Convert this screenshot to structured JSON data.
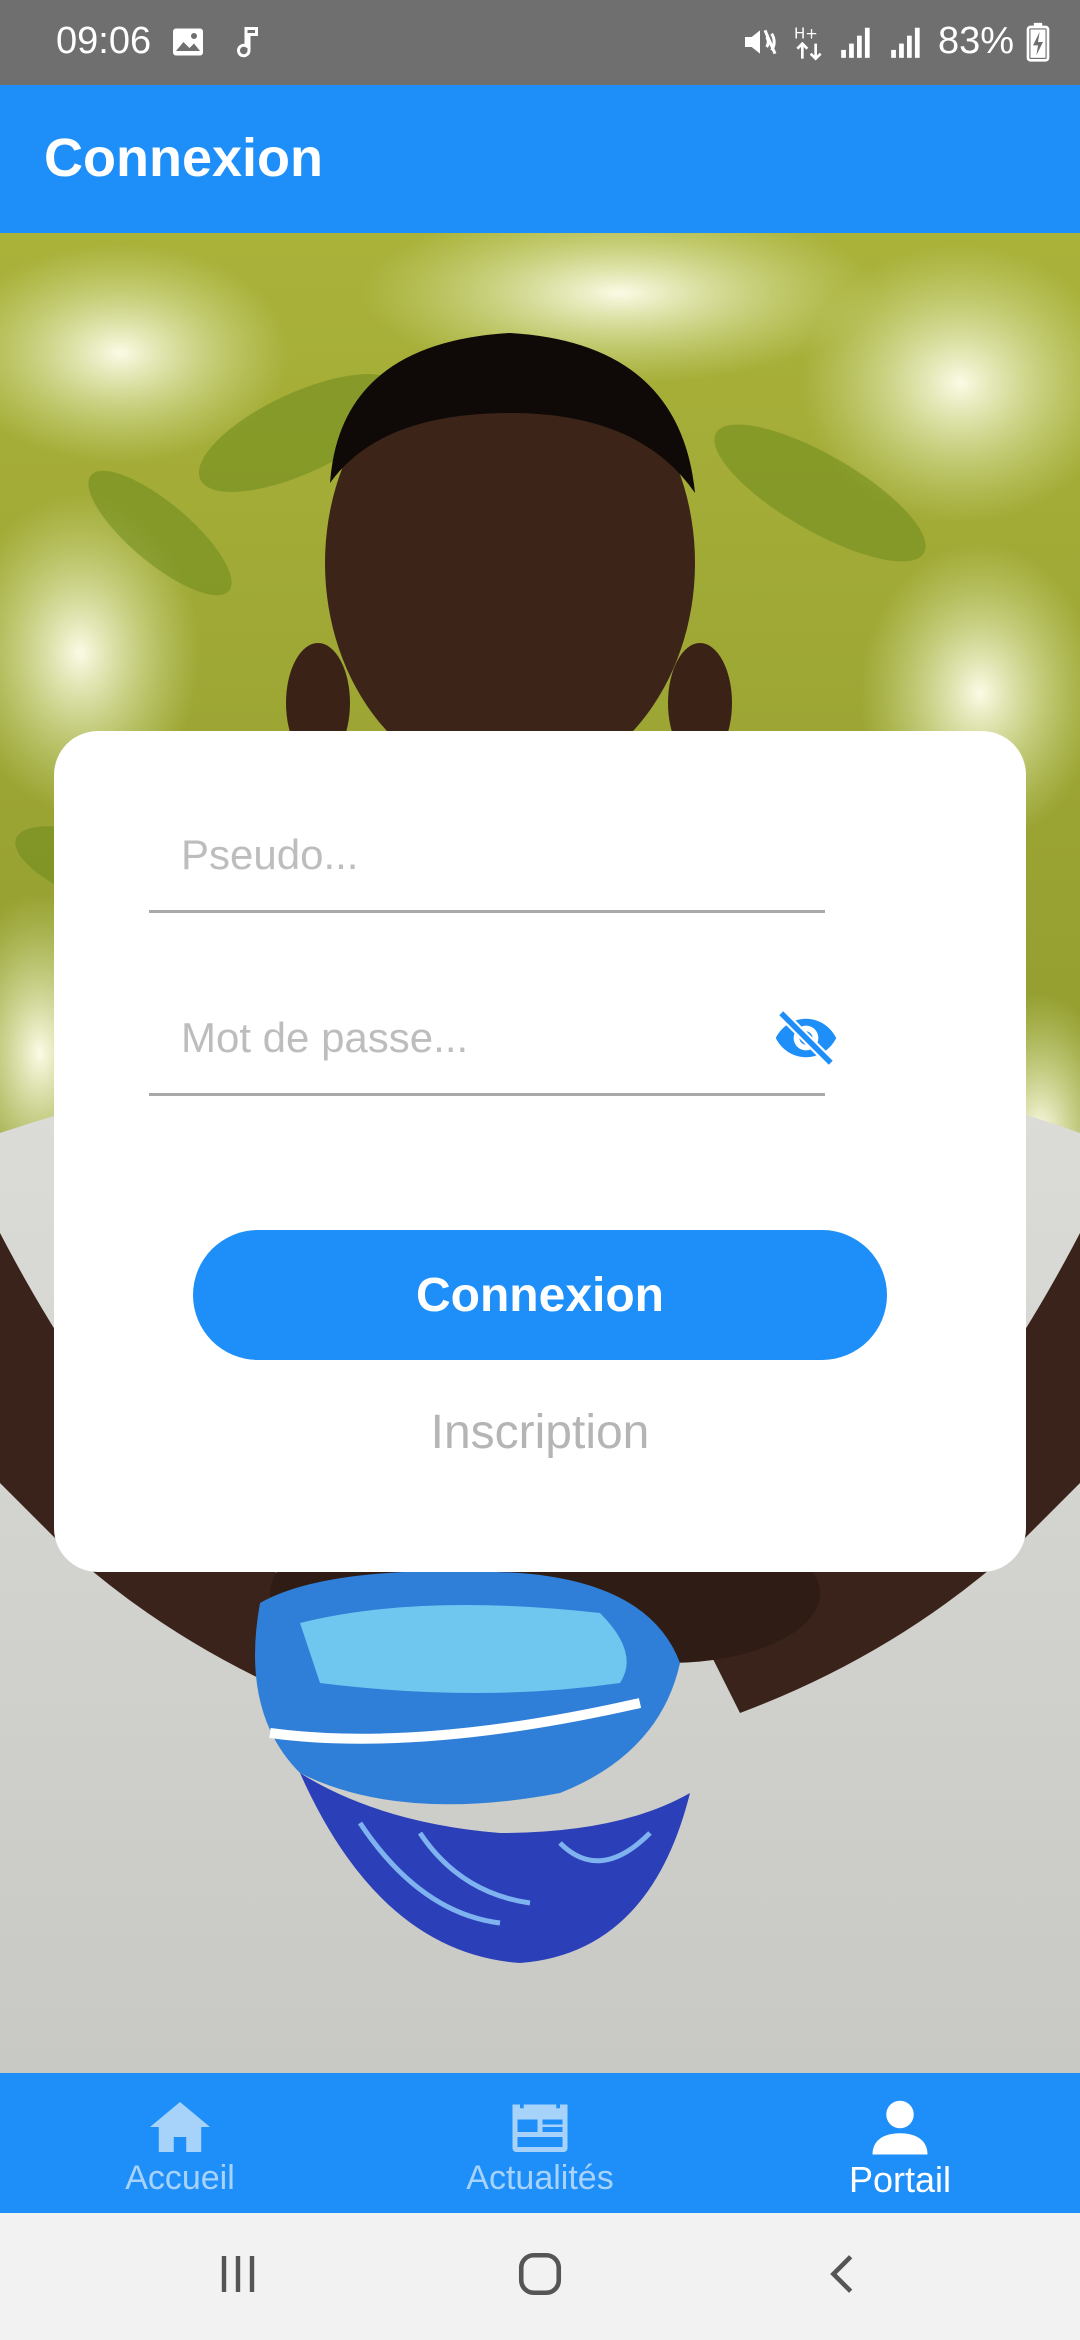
{
  "status_bar": {
    "time": "09:06",
    "battery": "83%",
    "icons": [
      "image-icon",
      "music-note-icon",
      "mute-icon",
      "data-arrows-icon",
      "signal-icon",
      "signal-icon",
      "battery-charging-icon"
    ]
  },
  "app_bar": {
    "title": "Connexion"
  },
  "login_form": {
    "username_placeholder": "Pseudo...",
    "password_placeholder": "Mot de passe...",
    "password_toggle_icon": "eye-off-icon",
    "submit_label": "Connexion",
    "signup_label": "Inscription"
  },
  "bottom_nav": {
    "items": [
      {
        "label": "Accueil",
        "icon": "home-icon",
        "active": false
      },
      {
        "label": "Actualités",
        "icon": "calendar-news-icon",
        "active": false
      },
      {
        "label": "Portail",
        "icon": "person-icon",
        "active": true
      }
    ]
  },
  "system_nav": {
    "icons": [
      "recent-apps-icon",
      "home-circle-icon",
      "back-icon"
    ]
  },
  "colors": {
    "primary": "#1e8ff8",
    "status_bar": "#6f6f6f",
    "placeholder": "#bdbdbd",
    "signup_text": "#b5b5b5",
    "nav_inactive": "#a7d3fb"
  }
}
